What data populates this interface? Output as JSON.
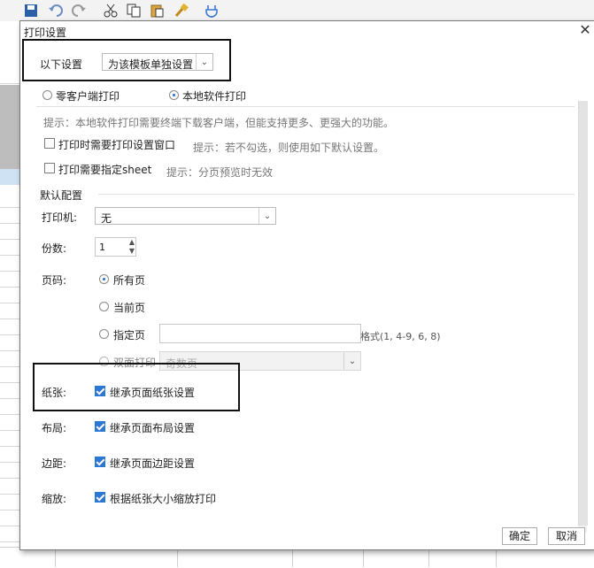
{
  "dialog": {
    "title": "打印设置",
    "close_glyph": "✕"
  },
  "scope": {
    "label": "以下设置",
    "selected": "为该模板单独设置"
  },
  "print_mode": {
    "client_label": "零客户端打印",
    "local_label": "本地软件打印",
    "selected": "local"
  },
  "hint_local": "提示：本地软件打印需要终端下载客户端，但能支持更多、更强大的功能。",
  "show_dialog": {
    "label": "打印时需要打印设置窗口",
    "checked": false,
    "hint": "提示：若不勾选，则使用如下默认设置。"
  },
  "sheet": {
    "label": "打印需要指定sheet",
    "checked": false,
    "hint": "提示：分页预览时无效"
  },
  "defaults": {
    "section_label": "默认配置",
    "printer": {
      "label": "打印机:",
      "value": "无"
    },
    "copies": {
      "label": "份数:",
      "value": "1"
    },
    "pages": {
      "label": "页码:",
      "all": "所有页",
      "current": "当前页",
      "specified": "指定页",
      "format_hint": "格式(1, 4-9, 6, 8)",
      "duplex": "双面打印",
      "duplex_select": "奇数页",
      "selected": "all"
    },
    "paper": {
      "label": "纸张:",
      "option": "继承页面纸张设置",
      "checked": true
    },
    "layout": {
      "label": "布局:",
      "option": "继承页面布局设置",
      "checked": true
    },
    "margin": {
      "label": "边距:",
      "option": "继承页面边距设置",
      "checked": true
    },
    "zoom": {
      "label": "缩放:",
      "option": "根据纸张大小缩放打印",
      "checked": true
    }
  },
  "buttons": {
    "ok": "确定",
    "cancel": "取消"
  },
  "colors": {
    "accent": "#2b77d6",
    "highlight_box": "#111111"
  }
}
